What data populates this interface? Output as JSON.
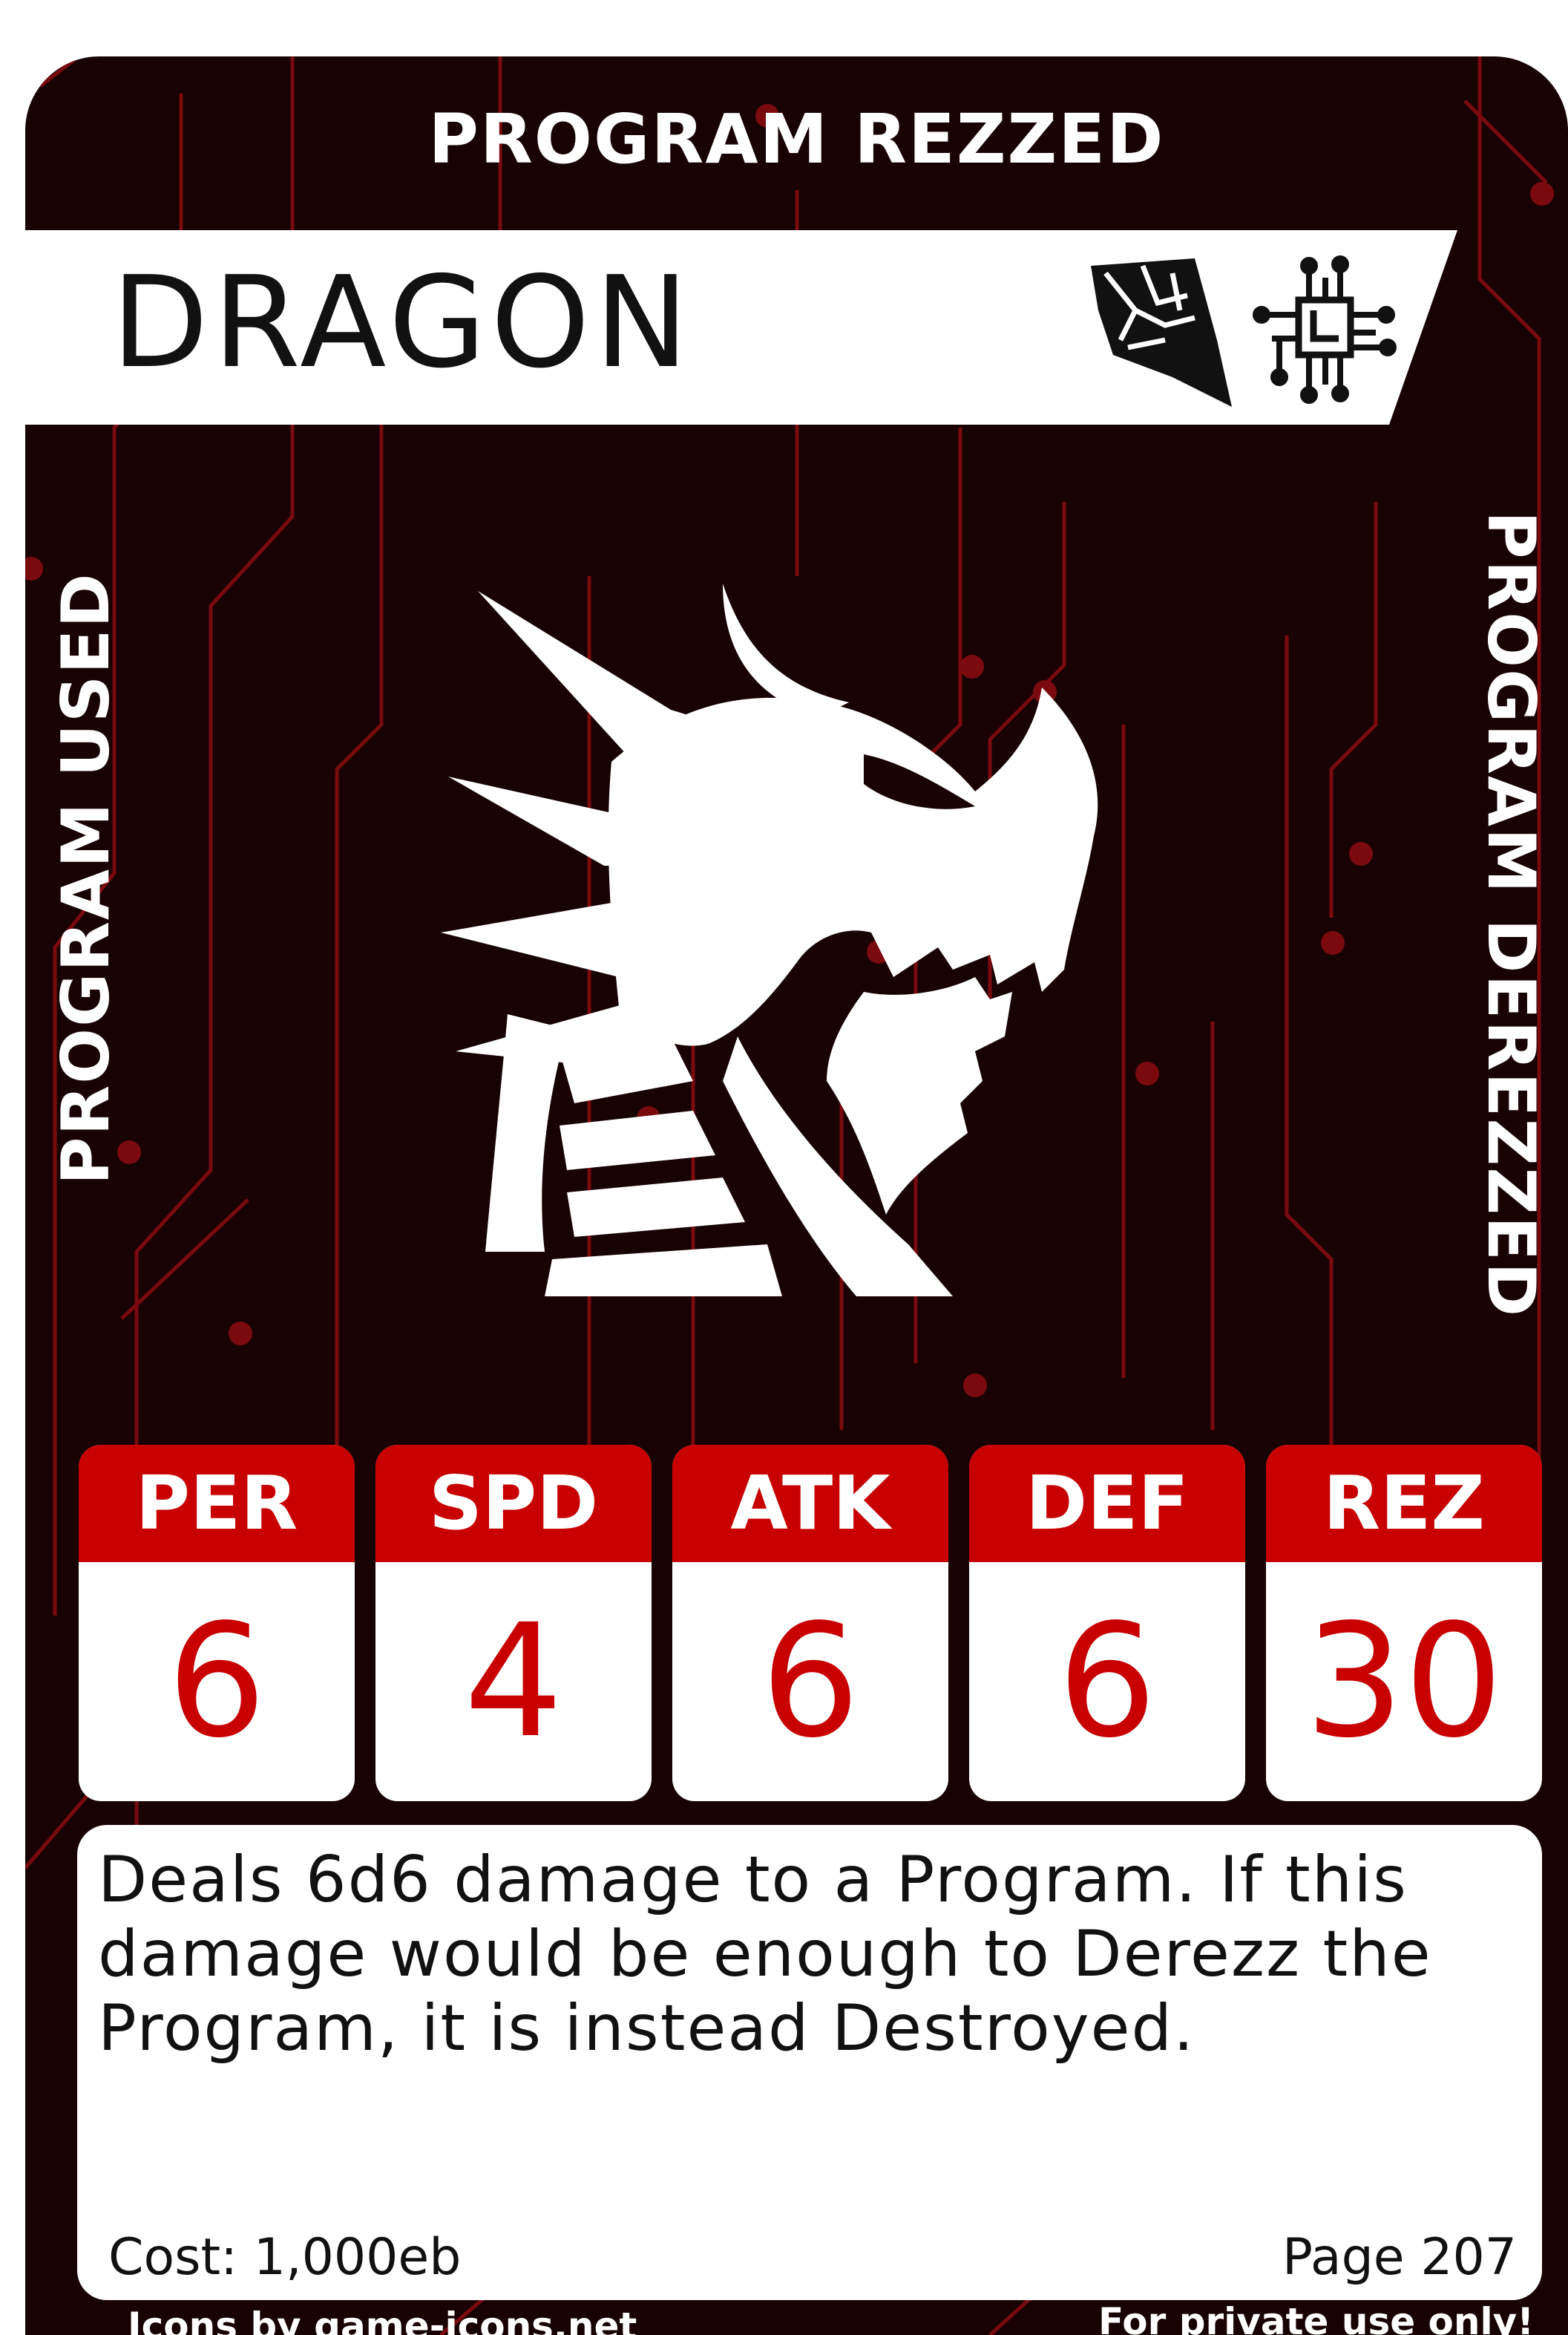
{
  "card": {
    "status_top": "PROGRAM REZZED",
    "status_left": "PROGRAM USED",
    "status_right": "PROGRAM DEREZZED",
    "name": "DRAGON",
    "type_icons": [
      "shattered-shard-icon",
      "circuit-chip-icon"
    ],
    "art_icon": "dragon-head-icon",
    "colors": {
      "accent": "#c80000",
      "background": "#180203",
      "trace": "#7a0a0d"
    }
  },
  "stats": [
    {
      "label": "PER",
      "value": "6"
    },
    {
      "label": "SPD",
      "value": "4"
    },
    {
      "label": "ATK",
      "value": "6"
    },
    {
      "label": "DEF",
      "value": "6"
    },
    {
      "label": "REZ",
      "value": "30"
    }
  ],
  "rules_text": "Deals 6d6 damage to a Program. If this damage would be enough to Derezz the Program, it is instead Destroyed.",
  "footer": {
    "cost": "Cost: 1,000eb",
    "page": "Page 207",
    "credit": "Icons by game-icons.net",
    "notice": "For private use only!"
  }
}
